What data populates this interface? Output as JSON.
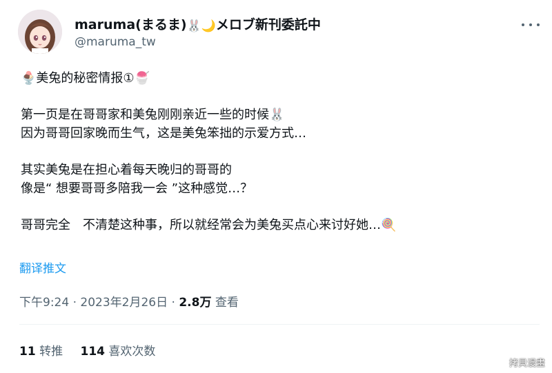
{
  "author": {
    "name": "maruma(まるま)",
    "name_emojis": "🐰🌙",
    "name_suffix": "メロブ新刊委託中",
    "handle": "@maruma_tw"
  },
  "tweet": {
    "line1_emoji_start": "🍨",
    "line1_text": "美兔的秘密情报①",
    "line1_emoji_end": "🍧",
    "line2_text": "第一页是在哥哥家和美兔刚刚亲近一些的时候",
    "line2_emoji": "🐰",
    "line3_text": "因为哥哥回家晚而生气，这是美兔笨拙的示爱方式…",
    "line4_text": "其实美兔是在担心着每天晚归的哥哥的",
    "line5_text": "像是“ 想要哥哥多陪我一会 ”这种感觉…？",
    "line6_text": "哥哥完全　不清楚这种事，所以就经常会为美兔买点心来讨好她…",
    "line6_emoji": "🍭"
  },
  "translate_label": "翻译推文",
  "meta": {
    "time": "下午9:24",
    "date": "2023年2月26日",
    "views_count": "2.8万",
    "views_label": "查看"
  },
  "stats": {
    "retweets_count": "11",
    "retweets_label": "转推",
    "likes_count": "114",
    "likes_label": "喜欢次数"
  },
  "watermark": "拷貝漫畫",
  "more_icon": "more-horizontal-icon"
}
